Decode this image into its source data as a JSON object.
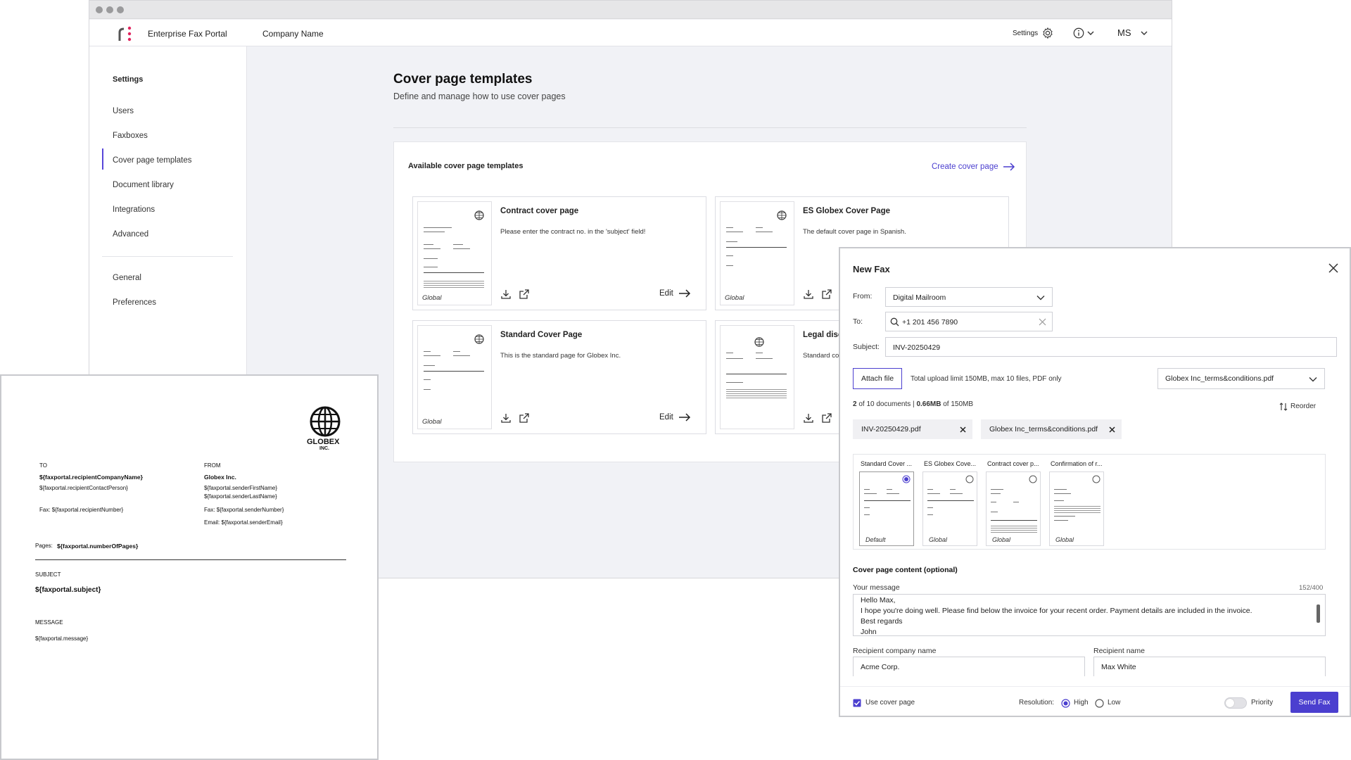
{
  "header": {
    "app_name": "Enterprise Fax Portal",
    "company": "Company Name",
    "settings_label": "Settings",
    "user_initials": "MS"
  },
  "sidebar": {
    "title": "Settings",
    "items": [
      {
        "label": "Users"
      },
      {
        "label": "Faxboxes"
      },
      {
        "label": "Cover page templates"
      },
      {
        "label": "Document library"
      },
      {
        "label": "Integrations"
      },
      {
        "label": "Advanced"
      },
      {
        "label": "General"
      },
      {
        "label": "Preferences"
      }
    ],
    "active_item": "Cover page templates"
  },
  "main": {
    "title": "Cover page templates",
    "subtitle": "Define and manage how to use cover pages",
    "panel_title": "Available cover page templates",
    "create_link": "Create cover page",
    "cards": [
      {
        "title": "Contract cover page",
        "desc": "Please enter the contract no. in the 'subject' field!",
        "tag": "Global",
        "edit": "Edit"
      },
      {
        "title": "ES Globex Cover Page",
        "desc": "The default cover page in Spanish.",
        "tag": "Global"
      },
      {
        "title": "Standard Cover Page",
        "desc": "This is the standard page for Globex Inc.",
        "tag": "Global",
        "edit": "Edit"
      },
      {
        "title": "Legal disc",
        "desc": "Standard co",
        "tag": ""
      }
    ]
  },
  "cover_preview": {
    "logo_line1": "GLOBEX",
    "logo_line2": "INC.",
    "to_label": "TO",
    "from_label": "FROM",
    "recipient_company": "${faxportal.recipientCompanyName}",
    "recipient_contact": "${faxportal.recipientContactPerson}",
    "recipient_fax": "Fax: ${faxportal.recipientNumber}",
    "sender_company": "Globex Inc.",
    "sender_first": "${faxportal.senderFirstName}",
    "sender_last": "${faxportal.senderLastName}",
    "sender_fax": "Fax: ${faxportal.senderNumber}",
    "sender_email": "Email: ${faxportal.senderEmail}",
    "pages_label": "Pages:",
    "pages_value": "${faxportal.numberOfPages}",
    "subject_label": "SUBJECT",
    "subject_value": "${faxportal.subject}",
    "message_label": "MESSAGE",
    "message_value": "${faxportal.message}"
  },
  "new_fax": {
    "title": "New Fax",
    "from_label": "From:",
    "from_value": "Digital Mailroom",
    "to_label": "To:",
    "to_value": "+1 201 456 7890",
    "subject_label": "Subject:",
    "subject_value": "INV-20250429",
    "attach_label": "Attach file",
    "upload_limit": "Total upload limit 150MB, max 10 files, PDF only",
    "selected_file": "Globex Inc_terms&conditions.pdf",
    "docs_count": "2",
    "docs_of": " of 10 documents | ",
    "docs_size": "0.66MB",
    "docs_size_of": " of 150MB",
    "reorder_label": "Reorder",
    "attachments": [
      "INV-20250429.pdf",
      "Globex Inc_terms&conditions.pdf"
    ],
    "templates": [
      {
        "title": "Standard Cover ...",
        "tag": "Default"
      },
      {
        "title": "ES Globex Cove...",
        "tag": "Global"
      },
      {
        "title": "Contract cover p...",
        "tag": "Global"
      },
      {
        "title": "Confirmation of r...",
        "tag": "Global"
      }
    ],
    "cover_content_label": "Cover page content (optional)",
    "message_label": "Your message",
    "message_count": "152/400",
    "message_lines": [
      "Hello Max,",
      "I hope you're doing well. Please find below the invoice for your recent order. Payment details are included in the invoice.",
      "Best regards",
      "John"
    ],
    "recipient_company_label": "Recipient company name",
    "recipient_company_value": "Acme Corp.",
    "recipient_name_label": "Recipient name",
    "recipient_name_value": "Max White",
    "use_cover_label": "Use cover page",
    "resolution_label": "Resolution:",
    "res_high": "High",
    "res_low": "Low",
    "priority_label": "Priority",
    "send_label": "Send Fax",
    "accent_color": "#4b3fcf"
  }
}
